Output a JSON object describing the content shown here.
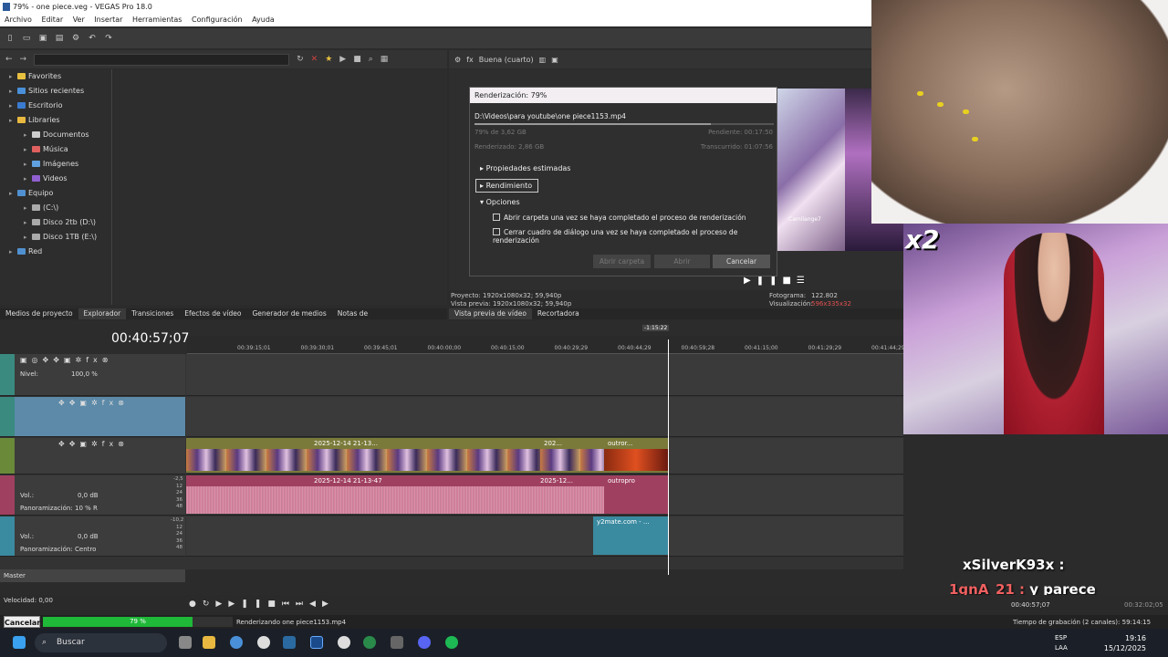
{
  "window": {
    "title": "79% - one piece.veg - VEGAS Pro 18.0"
  },
  "menu": [
    "Archivo",
    "Editar",
    "Ver",
    "Insertar",
    "Herramientas",
    "Configuración",
    "Ayuda"
  ],
  "explorer": {
    "tree": [
      {
        "label": "Favorites",
        "icon": "star-icon",
        "color": "#e8c040",
        "indent": 1
      },
      {
        "label": "Sitios recientes",
        "icon": "recent-places-icon",
        "color": "#4a90d9",
        "indent": 1
      },
      {
        "label": "Escritorio",
        "icon": "desktop-icon",
        "color": "#3a7ad0",
        "indent": 1
      },
      {
        "label": "Libraries",
        "icon": "libraries-icon",
        "color": "#e8b840",
        "indent": 1
      },
      {
        "label": "Documentos",
        "icon": "documents-icon",
        "color": "#cccccc",
        "indent": 2
      },
      {
        "label": "Música",
        "icon": "music-icon",
        "color": "#e06060",
        "indent": 2
      },
      {
        "label": "Imágenes",
        "icon": "images-icon",
        "color": "#60a0e0",
        "indent": 2
      },
      {
        "label": "Videos",
        "icon": "videos-icon",
        "color": "#9060d0",
        "indent": 2
      },
      {
        "label": "Equipo",
        "icon": "computer-icon",
        "color": "#5090d0",
        "indent": 1
      },
      {
        "label": "(C:\\)",
        "icon": "drive-icon",
        "color": "#aaaaaa",
        "indent": 2
      },
      {
        "label": "Disco 2tb (D:\\)",
        "icon": "drive-icon",
        "color": "#aaaaaa",
        "indent": 2
      },
      {
        "label": "Disco 1TB (E:\\)",
        "icon": "drive-icon",
        "color": "#aaaaaa",
        "indent": 2
      },
      {
        "label": "Red",
        "icon": "network-icon",
        "color": "#5090d0",
        "indent": 1
      }
    ],
    "tabs": [
      "Medios de proyecto",
      "Explorador",
      "Transiciones",
      "Efectos de vídeo",
      "Generador de medios",
      "Notas de"
    ]
  },
  "preview": {
    "quality": "Buena (cuarto)",
    "project_label": "Proyecto:",
    "project_value": "1920x1080x32; 59,940p",
    "vista_label": "Vista previa:",
    "vista_value": "1920x1080x32; 59,940p",
    "frame_label": "Fotograma:",
    "frame_value": "122.802",
    "display_label": "Visualización:",
    "display_value": "596x335x32",
    "thumb_name": "Camilange7",
    "tabs": [
      "Vista previa de vídeo",
      "Recortadora"
    ]
  },
  "dialog": {
    "title": "Renderización: 79%",
    "path": "D:\\Videos\\para youtube\\one piece1153.mp4",
    "progress": 0.79,
    "size_text": "79% de 3,62 GB",
    "pending": "Pendiente: 00:17:50",
    "rendered": "Renderizado: 2,86 GB",
    "elapsed": "Transcurrido: 01:07:56",
    "section1": "Propiedades estimadas",
    "section2": "Rendimiento",
    "section3": "Opciones",
    "check1": "Abrir carpeta una vez se haya completado el proceso de renderización",
    "check2": "Cerrar cuadro de diálogo una vez se haya completado el proceso de renderización",
    "btn_open_folder": "Abrir carpeta",
    "btn_open": "Abrir",
    "btn_cancel": "Cancelar"
  },
  "overlay": {
    "multiplier": "x2",
    "chat1_user": "xSilverK93x :",
    "chat2_user": "1gnA_21 :",
    "chat2_text": "y parece"
  },
  "timeline": {
    "timecode": "00:40:57;07",
    "marker": "-1:15:22",
    "ruler": [
      "00:39:15;01",
      "00:39:30;01",
      "00:39:45;01",
      "00:40:00;00",
      "00:40:15;00",
      "00:40:29;29",
      "00:40:44;29",
      "00:40:59;28",
      "00:41:15;00",
      "00:41:29;29",
      "00:41:44;29"
    ],
    "track1": {
      "level_label": "Nivel:",
      "level_value": "100,0 %"
    },
    "video_clips": [
      "2025-12-14 21-13...",
      "202...",
      "outror..."
    ],
    "audio_clips": [
      "2025-12-14 21-13-47",
      "2025-12...",
      "outropro"
    ],
    "audio1": {
      "vol_label": "Vol.:",
      "vol_value": "0,0 dB",
      "pan_label": "Panoramización:",
      "pan_value": "10 % R"
    },
    "audio2": {
      "vol_label": "Vol.:",
      "vol_value": "0,0 dB",
      "pan_label": "Panoramización:",
      "pan_value": "Centro"
    },
    "audio2_clip": "y2mate.com - ...",
    "db_scale1": [
      "-2,5",
      "12",
      "24",
      "36",
      "48"
    ],
    "db_scale2": [
      "-10,2",
      "12",
      "24",
      "36",
      "48"
    ],
    "master": "Master",
    "velocity": "Velocidad: 0,00",
    "end_time": "00:40:57;07",
    "end_time2": "00:32:02;05"
  },
  "status": {
    "cancel": "Cancelar",
    "progress_text": "79 %",
    "progress": 0.79,
    "rendering": "Renderizando one piece1153.mp4",
    "rec_time": "Tiempo de grabación (2 canales): 59:14:15"
  },
  "taskbar": {
    "search": "Buscar",
    "lang1": "ESP",
    "lang2": "LAA",
    "time": "19:16",
    "date": "15/12/2025"
  }
}
